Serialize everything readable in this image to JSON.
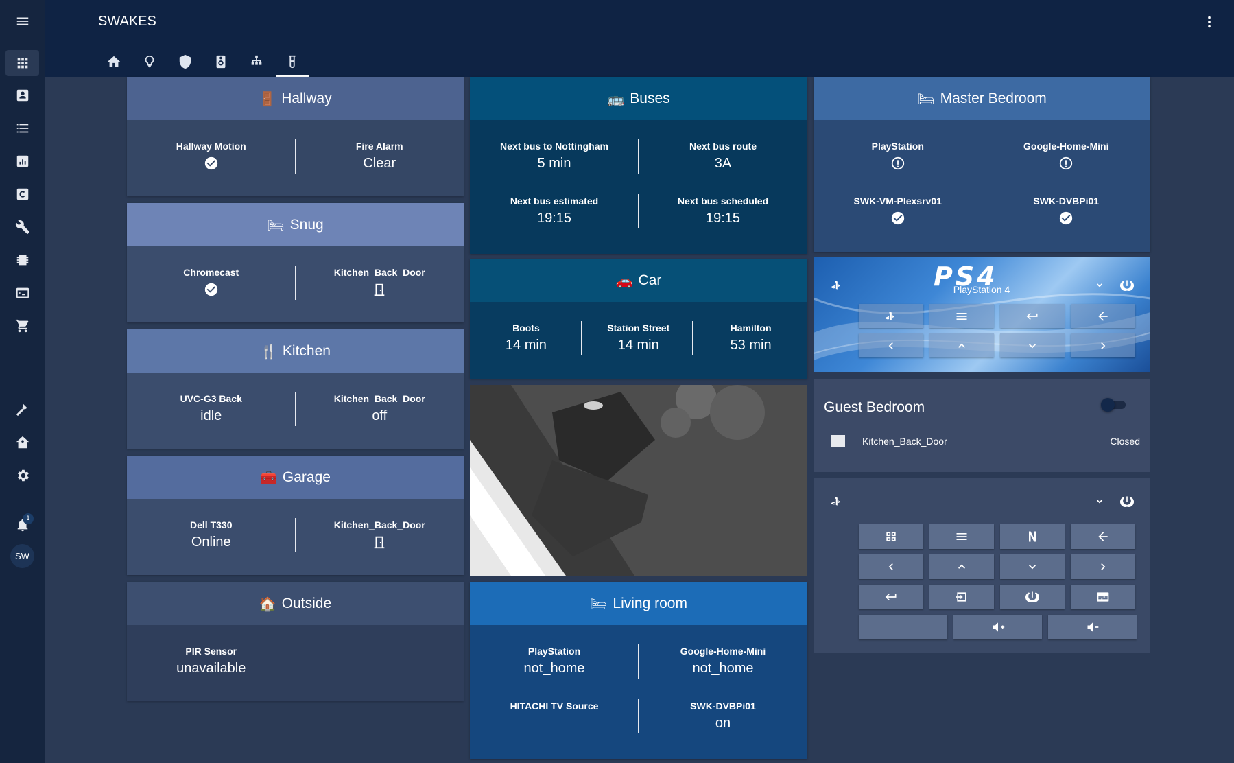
{
  "app": {
    "title": "SWAKES"
  },
  "sidebar": {
    "notification_count": "1",
    "avatar": "SW"
  },
  "hallway": {
    "title": "Hallway",
    "e1": {
      "label": "Hallway Motion"
    },
    "e2": {
      "label": "Fire Alarm",
      "value": "Clear"
    }
  },
  "snug": {
    "title": "Snug",
    "e1": {
      "label": "Chromecast"
    },
    "e2": {
      "label": "Kitchen_Back_Door"
    }
  },
  "kitchen": {
    "title": "Kitchen",
    "e1": {
      "label": "UVC-G3 Back",
      "value": "idle"
    },
    "e2": {
      "label": "Kitchen_Back_Door",
      "value": "off"
    }
  },
  "garage": {
    "title": "Garage",
    "e1": {
      "label": "Dell T330",
      "value": "Online"
    },
    "e2": {
      "label": "Kitchen_Back_Door"
    }
  },
  "outside": {
    "title": "Outside",
    "e1": {
      "label": "PIR Sensor",
      "value": "unavailable"
    }
  },
  "buses": {
    "title": "Buses",
    "e1": {
      "label": "Next bus to Nottingham",
      "value": "5 min"
    },
    "e2": {
      "label": "Next bus route",
      "value": "3A"
    },
    "e3": {
      "label": "Next bus estimated",
      "value": "19:15"
    },
    "e4": {
      "label": "Next bus scheduled",
      "value": "19:15"
    }
  },
  "car": {
    "title": "Car",
    "e1": {
      "label": "Boots",
      "value": "14 min"
    },
    "e2": {
      "label": "Station Street",
      "value": "14 min"
    },
    "e3": {
      "label": "Hamilton",
      "value": "53 min"
    }
  },
  "living": {
    "title": "Living room",
    "e1": {
      "label": "PlayStation",
      "value": "not_home"
    },
    "e2": {
      "label": "Google-Home-Mini",
      "value": "not_home"
    },
    "e3": {
      "label": "HITACHI TV Source",
      "value": ""
    },
    "e4": {
      "label": "SWK-DVBPi01",
      "value": "on"
    }
  },
  "master": {
    "title": "Master Bedroom",
    "e1": {
      "label": "PlayStation"
    },
    "e2": {
      "label": "Google-Home-Mini"
    },
    "e3": {
      "label": "SWK-VM-Plexsrv01"
    },
    "e4": {
      "label": "SWK-DVBPi01"
    }
  },
  "ps4": {
    "logo": "PS4",
    "subtitle": "PlayStation 4"
  },
  "guest": {
    "title": "Guest Bedroom",
    "entity": "Kitchen_Back_Door",
    "state": "Closed",
    "toggle_on": false
  }
}
